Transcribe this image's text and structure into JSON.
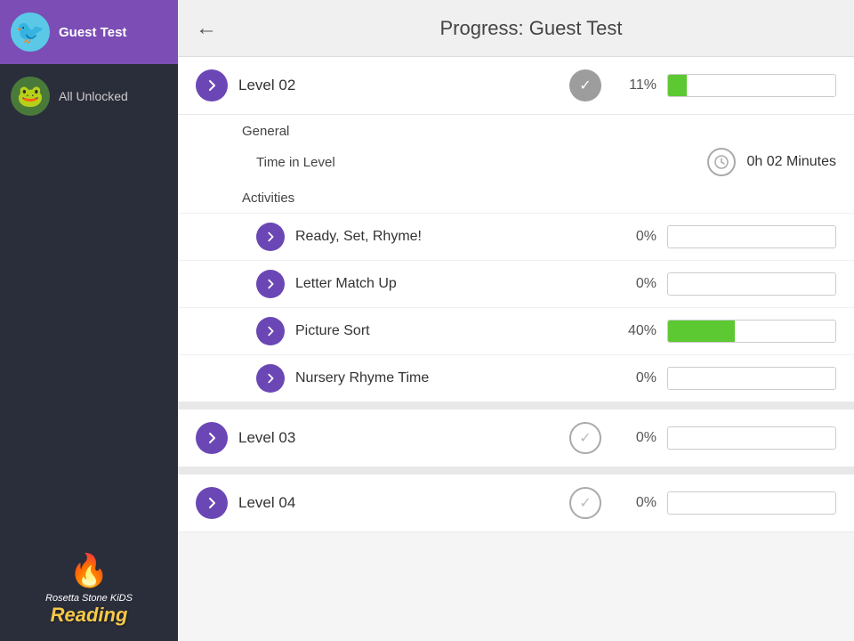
{
  "header": {
    "back_label": "←",
    "title": "Progress: Guest Test"
  },
  "sidebar": {
    "users": [
      {
        "name": "Guest Test",
        "avatar_emoji": "🐦",
        "avatar_bg": "#5bc8e8",
        "active": true
      },
      {
        "name": "All Unlocked",
        "avatar_emoji": "🐸",
        "avatar_bg": "#4a7a3a",
        "active": false
      }
    ],
    "logo": {
      "brand": "Rosetta Stone",
      "sub": "KiDS",
      "product": "Reading",
      "icon": "🔥"
    }
  },
  "levels": [
    {
      "id": "level-02",
      "name": "Level 02",
      "percent": "11%",
      "fill_width": 11,
      "expanded": true,
      "general": {
        "time_in_level_label": "Time in Level",
        "time_value": "0h 02  Minutes"
      },
      "activities": [
        {
          "name": "Ready, Set, Rhyme!",
          "percent": "0%",
          "fill_width": 0
        },
        {
          "name": "Letter Match Up",
          "percent": "0%",
          "fill_width": 0
        },
        {
          "name": "Picture Sort",
          "percent": "40%",
          "fill_width": 40
        },
        {
          "name": "Nursery Rhyme Time",
          "percent": "0%",
          "fill_width": 0
        }
      ]
    },
    {
      "id": "level-03",
      "name": "Level 03",
      "percent": "0%",
      "fill_width": 0,
      "expanded": false
    },
    {
      "id": "level-04",
      "name": "Level 04",
      "percent": "0%",
      "fill_width": 0,
      "expanded": false
    }
  ]
}
